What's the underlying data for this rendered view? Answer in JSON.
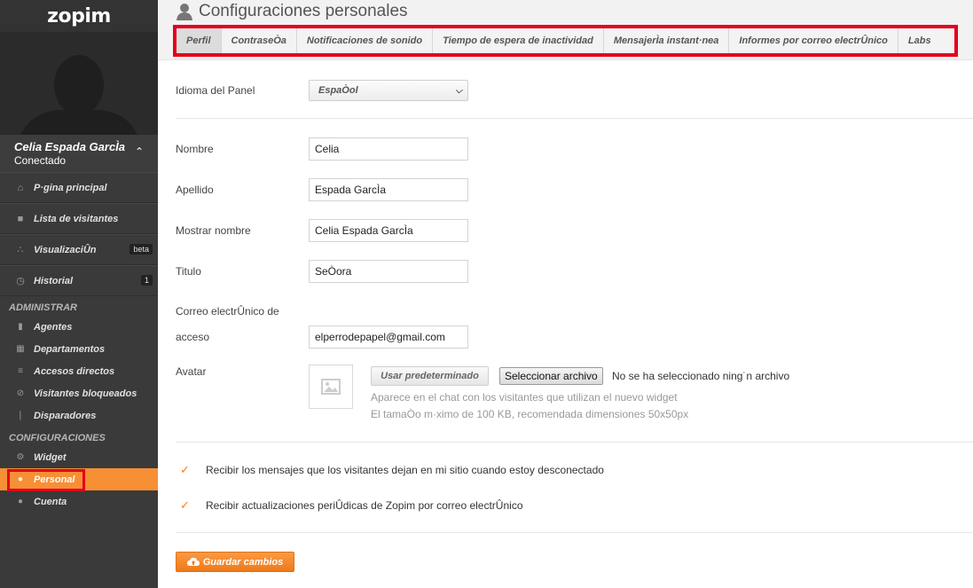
{
  "app": {
    "logo": "zopim"
  },
  "user": {
    "name": "Celia Espada GarcÌa",
    "status": "Conectado"
  },
  "sidebar": {
    "main_items": [
      {
        "label": "P·gina principal",
        "icon": "home-icon"
      },
      {
        "label": "Lista de visitantes",
        "icon": "chat-bubble-icon"
      },
      {
        "label": "VisualizaciÛn",
        "icon": "network-icon",
        "badge": "beta"
      },
      {
        "label": "Historial",
        "icon": "clock-icon",
        "badge": "1"
      }
    ],
    "admin_section": "ADMINISTRAR",
    "admin_items": [
      {
        "label": "Agentes",
        "icon": "agent-icon"
      },
      {
        "label": "Departamentos",
        "icon": "building-icon"
      },
      {
        "label": "Accesos directos",
        "icon": "shortcut-icon"
      },
      {
        "label": "Visitantes bloqueados",
        "icon": "blocked-icon"
      },
      {
        "label": "Disparadores",
        "icon": "trigger-icon"
      }
    ],
    "config_section": "CONFIGURACIONES",
    "config_items": [
      {
        "label": "Widget",
        "icon": "gear-icon"
      },
      {
        "label": "Personal",
        "icon": "person-icon",
        "active": true
      },
      {
        "label": "Cuenta",
        "icon": "users-icon"
      }
    ]
  },
  "header": {
    "title": "Configuraciones personales",
    "tabs": [
      "Perfil",
      "ContraseÒa",
      "Notificaciones de sonido",
      "Tiempo de espera de inactividad",
      "MensajerÌa instant·nea",
      "Informes por correo electrÛnico",
      "Labs"
    ],
    "active_tab": "Perfil"
  },
  "form": {
    "language_label": "Idioma del Panel",
    "language_value": "EspaÒol",
    "first_name_label": "Nombre",
    "first_name_value": "Celia",
    "last_name_label": "Apellido",
    "last_name_value": "Espada GarcÌa",
    "display_name_label": "Mostrar nombre",
    "display_name_value": "Celia Espada GarcÌa",
    "title_label": "Titulo",
    "title_value": "SeÒora",
    "email_label_line1": "Correo electrÛnico de",
    "email_label_line2": "acceso",
    "email_value": "elperrodepapel@gmail.com",
    "avatar_label": "Avatar",
    "use_default_label": "Usar predeterminado",
    "choose_file_label": "Seleccionar archivo",
    "no_file_text": "No se ha seleccionado ning˙n archivo",
    "avatar_hint1": "Aparece en el chat con los visitantes que utilizan el nuevo widget",
    "avatar_hint2": "El tamaÒo m·ximo de 100 KB, recomendada dimensiones 50x50px",
    "offline_msgs_label": "Recibir los mensajes que los visitantes dejan en mi sitio cuando estoy desconectado",
    "updates_label": "Recibir actualizaciones periÛdicas de Zopim por correo electrÛnico",
    "save_label": "Guardar cambios"
  },
  "colors": {
    "accent": "#f78f35",
    "highlight": "#e4001b",
    "sidebar": "#3a3a3a"
  }
}
